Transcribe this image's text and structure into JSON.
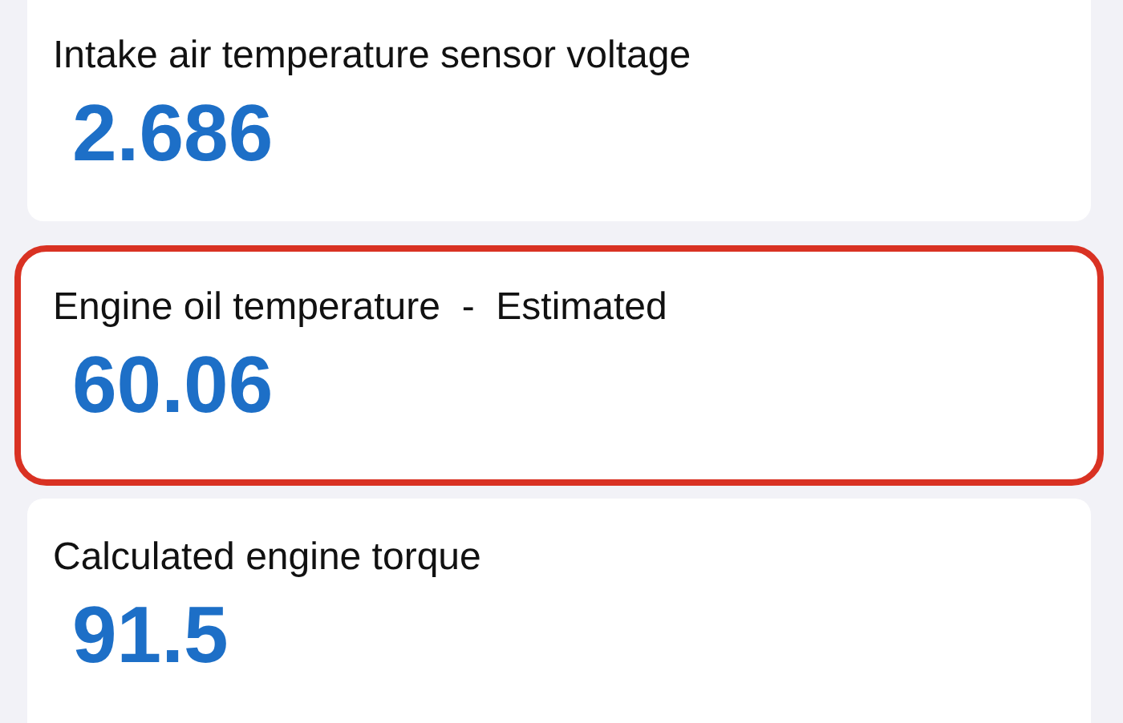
{
  "readings": [
    {
      "label": "Intake air temperature sensor voltage",
      "value": "2.686",
      "highlighted": false
    },
    {
      "label": "Engine oil temperature  -  Estimated",
      "value": "60.06",
      "highlighted": true
    },
    {
      "label": "Calculated engine torque",
      "value": "91.5",
      "highlighted": false
    }
  ]
}
